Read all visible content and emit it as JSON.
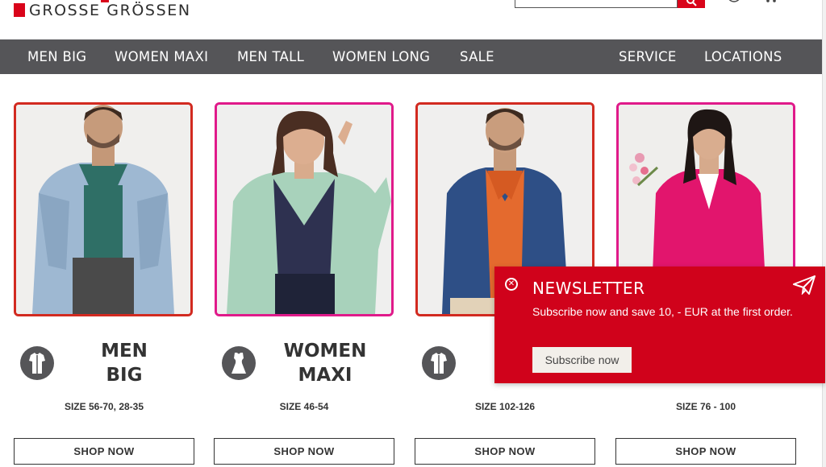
{
  "brand": {
    "logo_text": "GROSSE GRÖSSEN",
    "brand_color": "#d9041a"
  },
  "nav": {
    "left_items": [
      "MEN BIG",
      "WOMEN MAXI",
      "MEN TALL",
      "WOMEN LONG",
      "SALE"
    ],
    "right_items": [
      "SERVICE",
      "LOCATIONS"
    ],
    "background": "#555558"
  },
  "products": [
    {
      "title_line1": "MEN",
      "title_line2": "BIG",
      "size": "SIZE 56-70, 28-35",
      "button": "SHOP NOW",
      "frame_color": "#d22a20",
      "icon": "shirt-icon"
    },
    {
      "title_line1": "WOMEN",
      "title_line2": "MAXI",
      "size": "SIZE 46-54",
      "button": "SHOP NOW",
      "frame_color": "#e01a8a",
      "icon": "dress-icon"
    },
    {
      "title_line1": "",
      "title_line2": "",
      "size": "SIZE 102-126",
      "button": "SHOP NOW",
      "frame_color": "#d22a20",
      "icon": "shirt-icon"
    },
    {
      "title_line1": "",
      "title_line2": "",
      "size": "SIZE 76 - 100",
      "button": "SHOP NOW",
      "frame_color": "#e01a8a",
      "icon": "dress-icon"
    }
  ],
  "newsletter": {
    "title": "NEWSLETTER",
    "text": "Subscribe now and save 10, - EUR at the first order.",
    "button": "Subscribe now",
    "close_icon": "close-icon",
    "plane_icon": "paper-plane-icon",
    "background": "#d0021b"
  }
}
